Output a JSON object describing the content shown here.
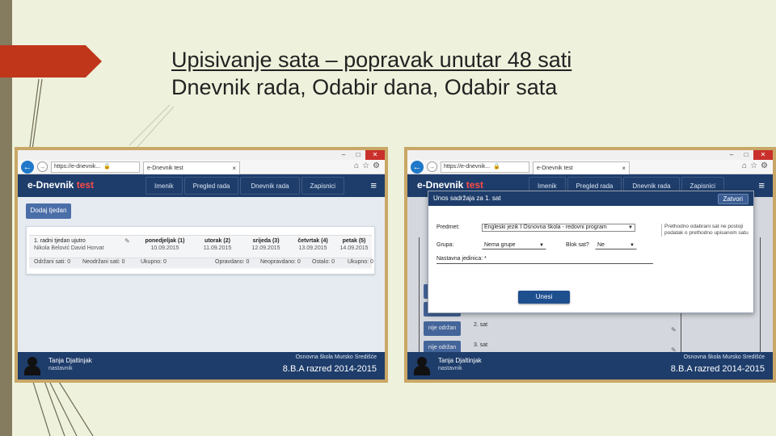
{
  "slide": {
    "title_line1": "Upisivanje sata – popravak unutar 48 sati",
    "title_line2": "Dnevnik rada, Odabir dana, Odabir sata"
  },
  "colors": {
    "app_navy": "#1e3d6b",
    "accent_red": "#c0361b",
    "frame_gold": "#c9a766",
    "button_blue": "#4a6ea8"
  },
  "browser": {
    "url": "https://e-dnevnik...",
    "tab_label": "e-Dnevnik test"
  },
  "app": {
    "logo_main": "e-Dnevnik",
    "logo_suffix": " test",
    "nav": [
      "Imenik",
      "Pregled rada",
      "Dnevnik rada",
      "Zapisnici"
    ],
    "menu_icon": "hamburger-icon"
  },
  "screen1": {
    "add_week_button": "Dodaj tjedan",
    "week": {
      "label": "1. radni tjedan ujutro",
      "teachers": "Nikola Belović  David Horvat",
      "days": [
        {
          "name": "ponedjeljak (1)",
          "date": "10.09.2015"
        },
        {
          "name": "utorak (2)",
          "date": "11.09.2015"
        },
        {
          "name": "srijeda (3)",
          "date": "12.09.2015"
        },
        {
          "name": "četvrtak (4)",
          "date": "13.09.2015"
        },
        {
          "name": "petak (5)",
          "date": "14.09.2015"
        }
      ],
      "stats": [
        "Održani sati: 0",
        "Neodržani sati: 0",
        "Ukupno: 0",
        "Opravdano: 0",
        "Neopravdano: 0",
        "Ostalo: 0",
        "Ukupno: 0"
      ]
    }
  },
  "screen2": {
    "bg_buttons": [
      "",
      "",
      "nije održan",
      "nije održan"
    ],
    "bg_hours": [
      "2. sat",
      "3. sat"
    ],
    "modal": {
      "title": "Unos sadržaja za 1. sat",
      "close_button": "Zatvori",
      "subject_label": "Predmet:",
      "subject_value": "Engleski jezik I Osnovna škola - redovni program",
      "group_label": "Grupa:",
      "group_value": "Nema grupe",
      "block_label": "Blok sat?",
      "block_value": "Ne",
      "unit_label": "Nastavna jedinica:",
      "unit_marker": "*",
      "note": "Prethodno odabrani sat ne postoji podatak o prethodno upisanom satu",
      "submit_button": "Unesi"
    }
  },
  "footer": {
    "user_name": "Tanja Djaltinjak",
    "user_role": "nastavnik",
    "school": "Osnovna škola Mursko Središće",
    "class": "8.B.A razred 2014-2015"
  }
}
